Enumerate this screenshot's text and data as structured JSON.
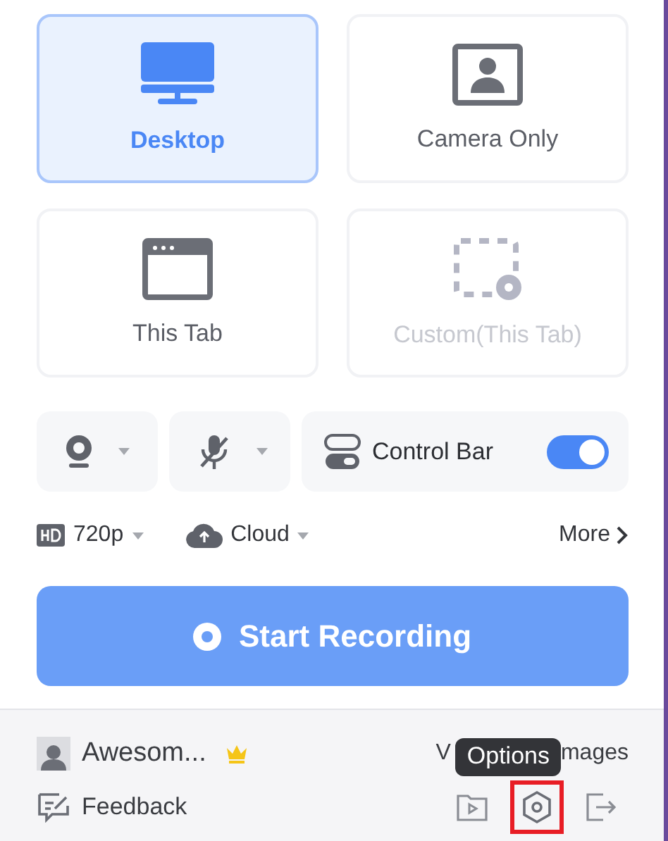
{
  "modes": [
    {
      "kind": "desktop",
      "label": "Desktop",
      "selected": true,
      "disabled": false
    },
    {
      "kind": "camera",
      "label": "Camera Only",
      "selected": false,
      "disabled": false
    },
    {
      "kind": "tab",
      "label": "This Tab",
      "selected": false,
      "disabled": false
    },
    {
      "kind": "custom",
      "label": "Custom(This Tab)",
      "selected": false,
      "disabled": true
    }
  ],
  "devices": {
    "camera": {
      "kind": "camera"
    },
    "microphone": {
      "kind": "mic-off"
    },
    "control_bar": {
      "label": "Control Bar",
      "on": true
    }
  },
  "settings": {
    "quality": "720p",
    "storage": "Cloud",
    "more": "More"
  },
  "start_button": "Start Recording",
  "footer": {
    "user": "Awesom...",
    "premium": true,
    "library_link": [
      "V",
      "mages"
    ],
    "feedback": "Feedback",
    "icons": [
      {
        "kind": "video-folder",
        "highlighted": false
      },
      {
        "kind": "options",
        "highlighted": true
      },
      {
        "kind": "exit",
        "highlighted": false
      }
    ],
    "tooltip": "Options"
  }
}
